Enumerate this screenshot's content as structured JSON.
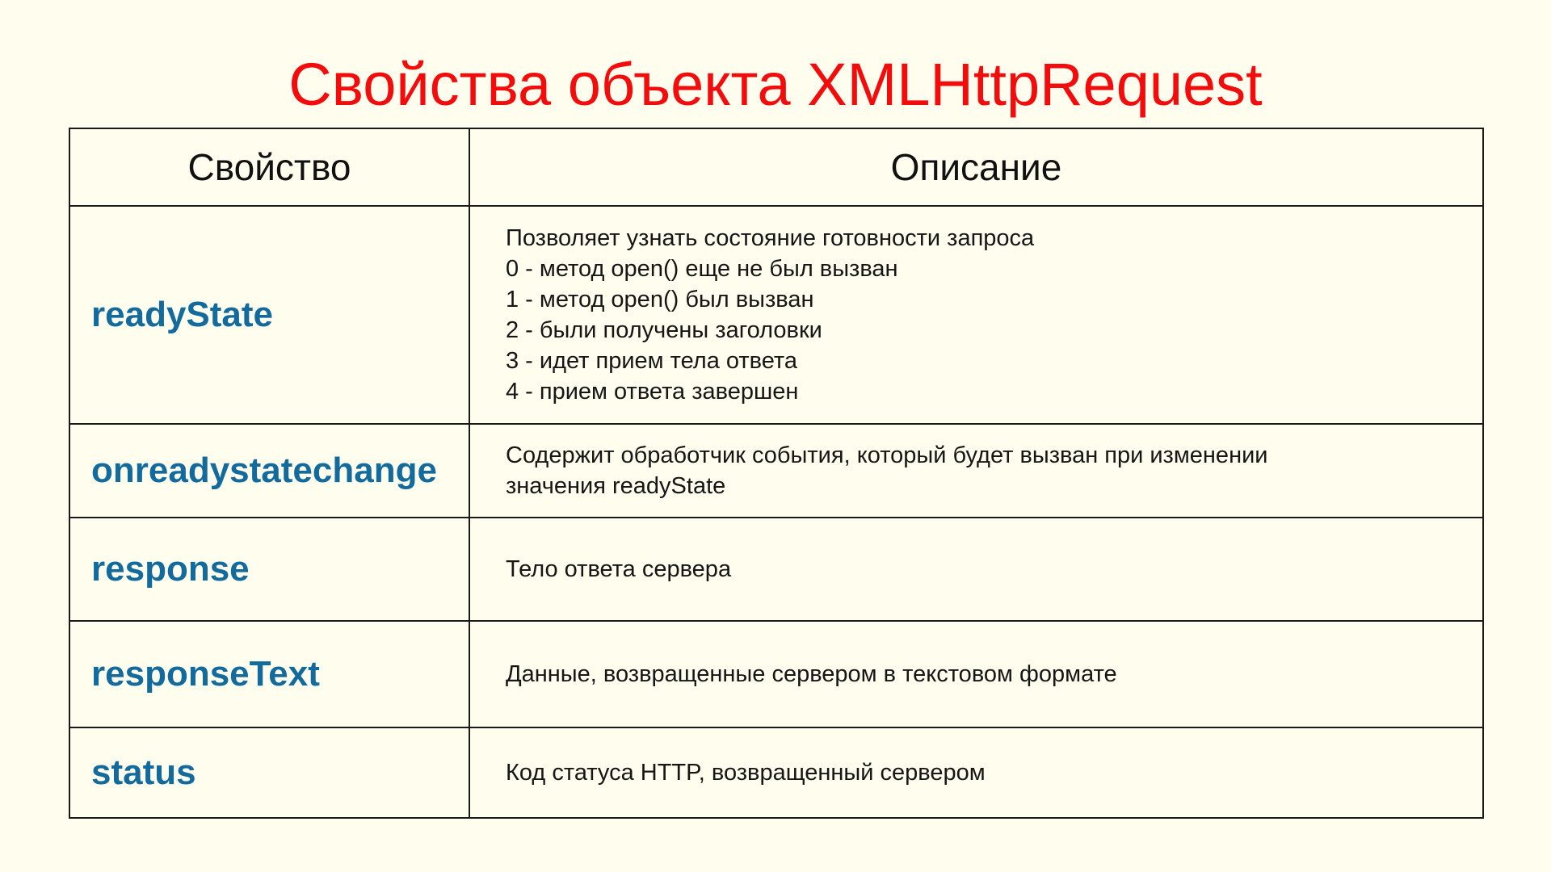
{
  "title": "Свойства объекта XMLHttpRequest",
  "table": {
    "headers": [
      "Свойство",
      "Описание"
    ],
    "rows": [
      {
        "name": "readyState",
        "description_lines": [
          "Позволяет узнать состояние готовности запроса",
          "0 - метод open() еще не был вызван",
          "1 - метод open() был вызван",
          "2 - были получены заголовки",
          "3 - идет прием тела ответа",
          "4 - прием ответа завершен"
        ]
      },
      {
        "name": "onreadystatechange",
        "description_lines": [
          "Содержит обработчик события, который будет вызван при изменении",
          "значения readyState"
        ]
      },
      {
        "name": "response",
        "description_lines": [
          "Тело ответа сервера"
        ]
      },
      {
        "name": "responseText",
        "description_lines": [
          "Данные, возвращенные сервером в текстовом формате"
        ]
      },
      {
        "name": "status",
        "description_lines": [
          "Код статуса HTTP, возвращенный сервером"
        ]
      }
    ]
  },
  "colors": {
    "background": "#fefdee",
    "title": "#f20c0c",
    "property_name": "#136a9c",
    "text": "#161616",
    "border": "#1a1a1a"
  }
}
